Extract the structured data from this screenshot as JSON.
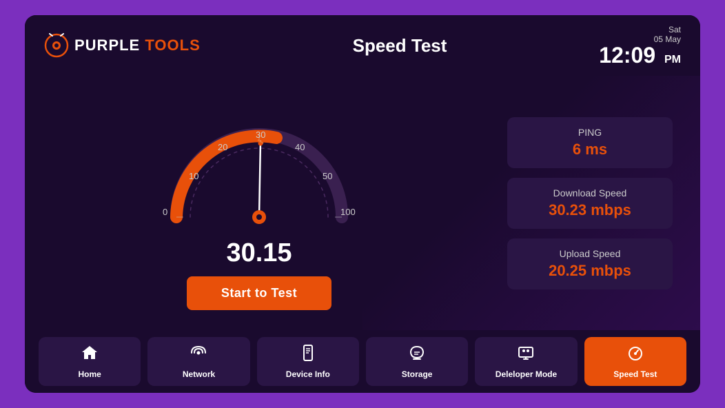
{
  "header": {
    "logo_purple": "PURPLE",
    "logo_tools": "TOOLS",
    "title": "Speed Test",
    "date_day": "Sat",
    "date": "05 May",
    "time": "12:09",
    "ampm": "PM"
  },
  "gauge": {
    "value": "30.15",
    "labels": {
      "n0": "0",
      "n10": "10",
      "n20": "20",
      "n30": "30",
      "n40": "40",
      "n50": "50",
      "n100": "100"
    }
  },
  "stats": [
    {
      "label": "PING",
      "value": "6 ms"
    },
    {
      "label": "Download Speed",
      "value": "30.23 mbps"
    },
    {
      "label": "Upload Speed",
      "value": "20.25 mbps"
    }
  ],
  "start_button": "Start to Test",
  "nav": [
    {
      "id": "home",
      "label": "Home",
      "icon": "🏠",
      "active": false
    },
    {
      "id": "network",
      "label": "Network",
      "icon": "📶",
      "active": false
    },
    {
      "id": "device-info",
      "label": "Device Info",
      "icon": "📱",
      "active": false
    },
    {
      "id": "storage",
      "label": "Storage",
      "icon": "☁",
      "active": false
    },
    {
      "id": "developer-mode",
      "label": "Deleloper Mode",
      "icon": "🖥",
      "active": false
    },
    {
      "id": "speed-test",
      "label": "Speed Test",
      "icon": "⏱",
      "active": true
    }
  ]
}
